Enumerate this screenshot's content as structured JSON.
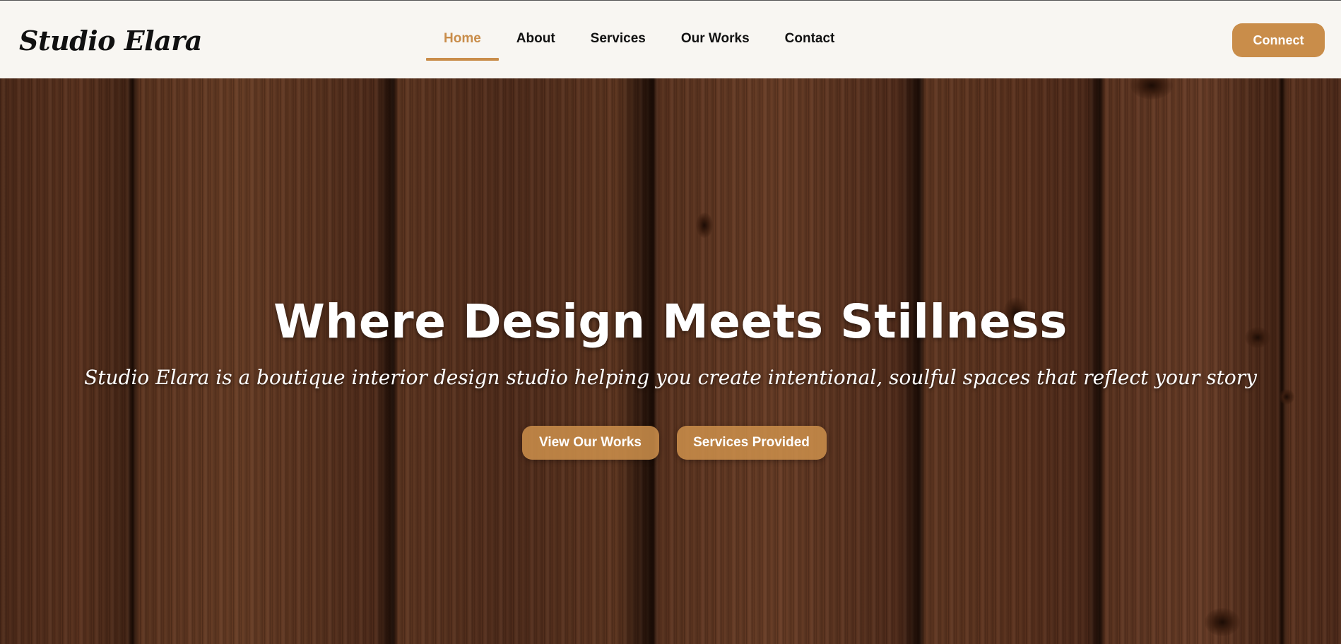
{
  "brand": {
    "logo": "Studio Elara"
  },
  "nav": {
    "items": [
      {
        "label": "Home",
        "active": true
      },
      {
        "label": "About",
        "active": false
      },
      {
        "label": "Services",
        "active": false
      },
      {
        "label": "Our Works",
        "active": false
      },
      {
        "label": "Contact",
        "active": false
      }
    ]
  },
  "header": {
    "connect_label": "Connect"
  },
  "hero": {
    "title": "Where Design Meets Stillness",
    "subtitle": "Studio Elara is a boutique interior design studio helping you create intentional, soulful spaces that reflect your story",
    "buttons": {
      "primary_label": "View Our Works",
      "secondary_label": "Services Provided"
    },
    "background": "wood-plank-texture"
  },
  "colors": {
    "accent": "#c98d4a",
    "header_bg": "#f8f6f2",
    "text_dark": "#111111",
    "hero_text": "#ffffff"
  }
}
